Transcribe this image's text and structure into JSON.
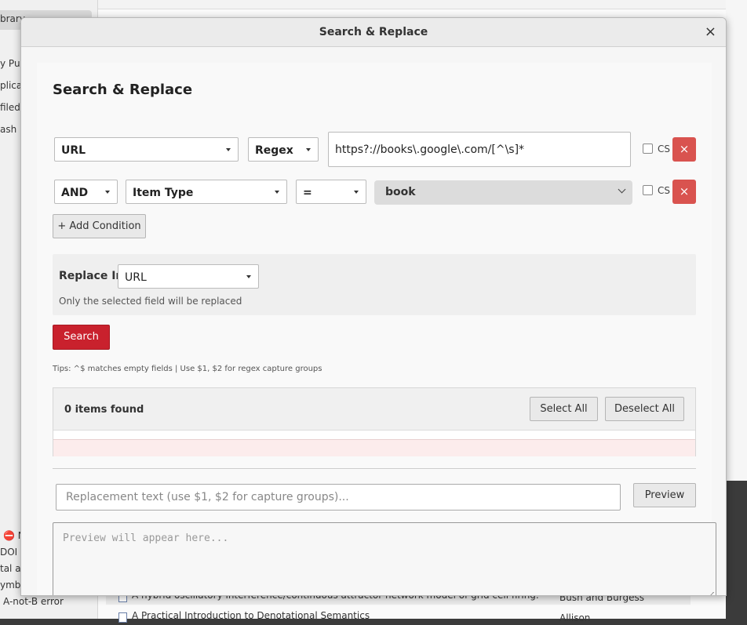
{
  "background": {
    "sidebar": {
      "library_label": "brary",
      "items": [
        "y Pub",
        "plica",
        "filed",
        "ash"
      ],
      "bottom_items": [
        "N",
        "DOI",
        "tal as",
        "ymbo",
        "A-not-B error"
      ]
    },
    "list_rows": [
      {
        "title": "A hybrid oscillatory interference/continuous attractor network model of grid cell firing.",
        "author": "Bush and Burgess"
      },
      {
        "title": "A Practical Introduction to Denotational Semantics",
        "author": "Allison"
      }
    ]
  },
  "dialog": {
    "title": "Search & Replace",
    "close_glyph": "×",
    "heading": "Search & Replace",
    "conditions": [
      {
        "field": "URL",
        "operator": "Regex",
        "value": "https?://books\\.google\\.com/[^\\s]*",
        "cs_label": "CS",
        "remove_glyph": "×"
      },
      {
        "logic": "AND",
        "field": "Item Type",
        "operator": "=",
        "value": "book",
        "cs_label": "CS",
        "remove_glyph": "×"
      }
    ],
    "add_condition_label": "+ Add Condition",
    "replace_in": {
      "label": "Replace In:",
      "field": "URL",
      "hint": "Only the selected field will be replaced"
    },
    "search_label": "Search",
    "tips": "Tips: ^$ matches empty fields | Use $1, $2 for regex capture groups",
    "results": {
      "count_label": "0 items found",
      "select_all_label": "Select All",
      "deselect_all_label": "Deselect All"
    },
    "replacement": {
      "placeholder": "Replacement text (use $1, $2 for capture groups)...",
      "preview_label": "Preview",
      "preview_placeholder": "Preview will appear here..."
    }
  }
}
